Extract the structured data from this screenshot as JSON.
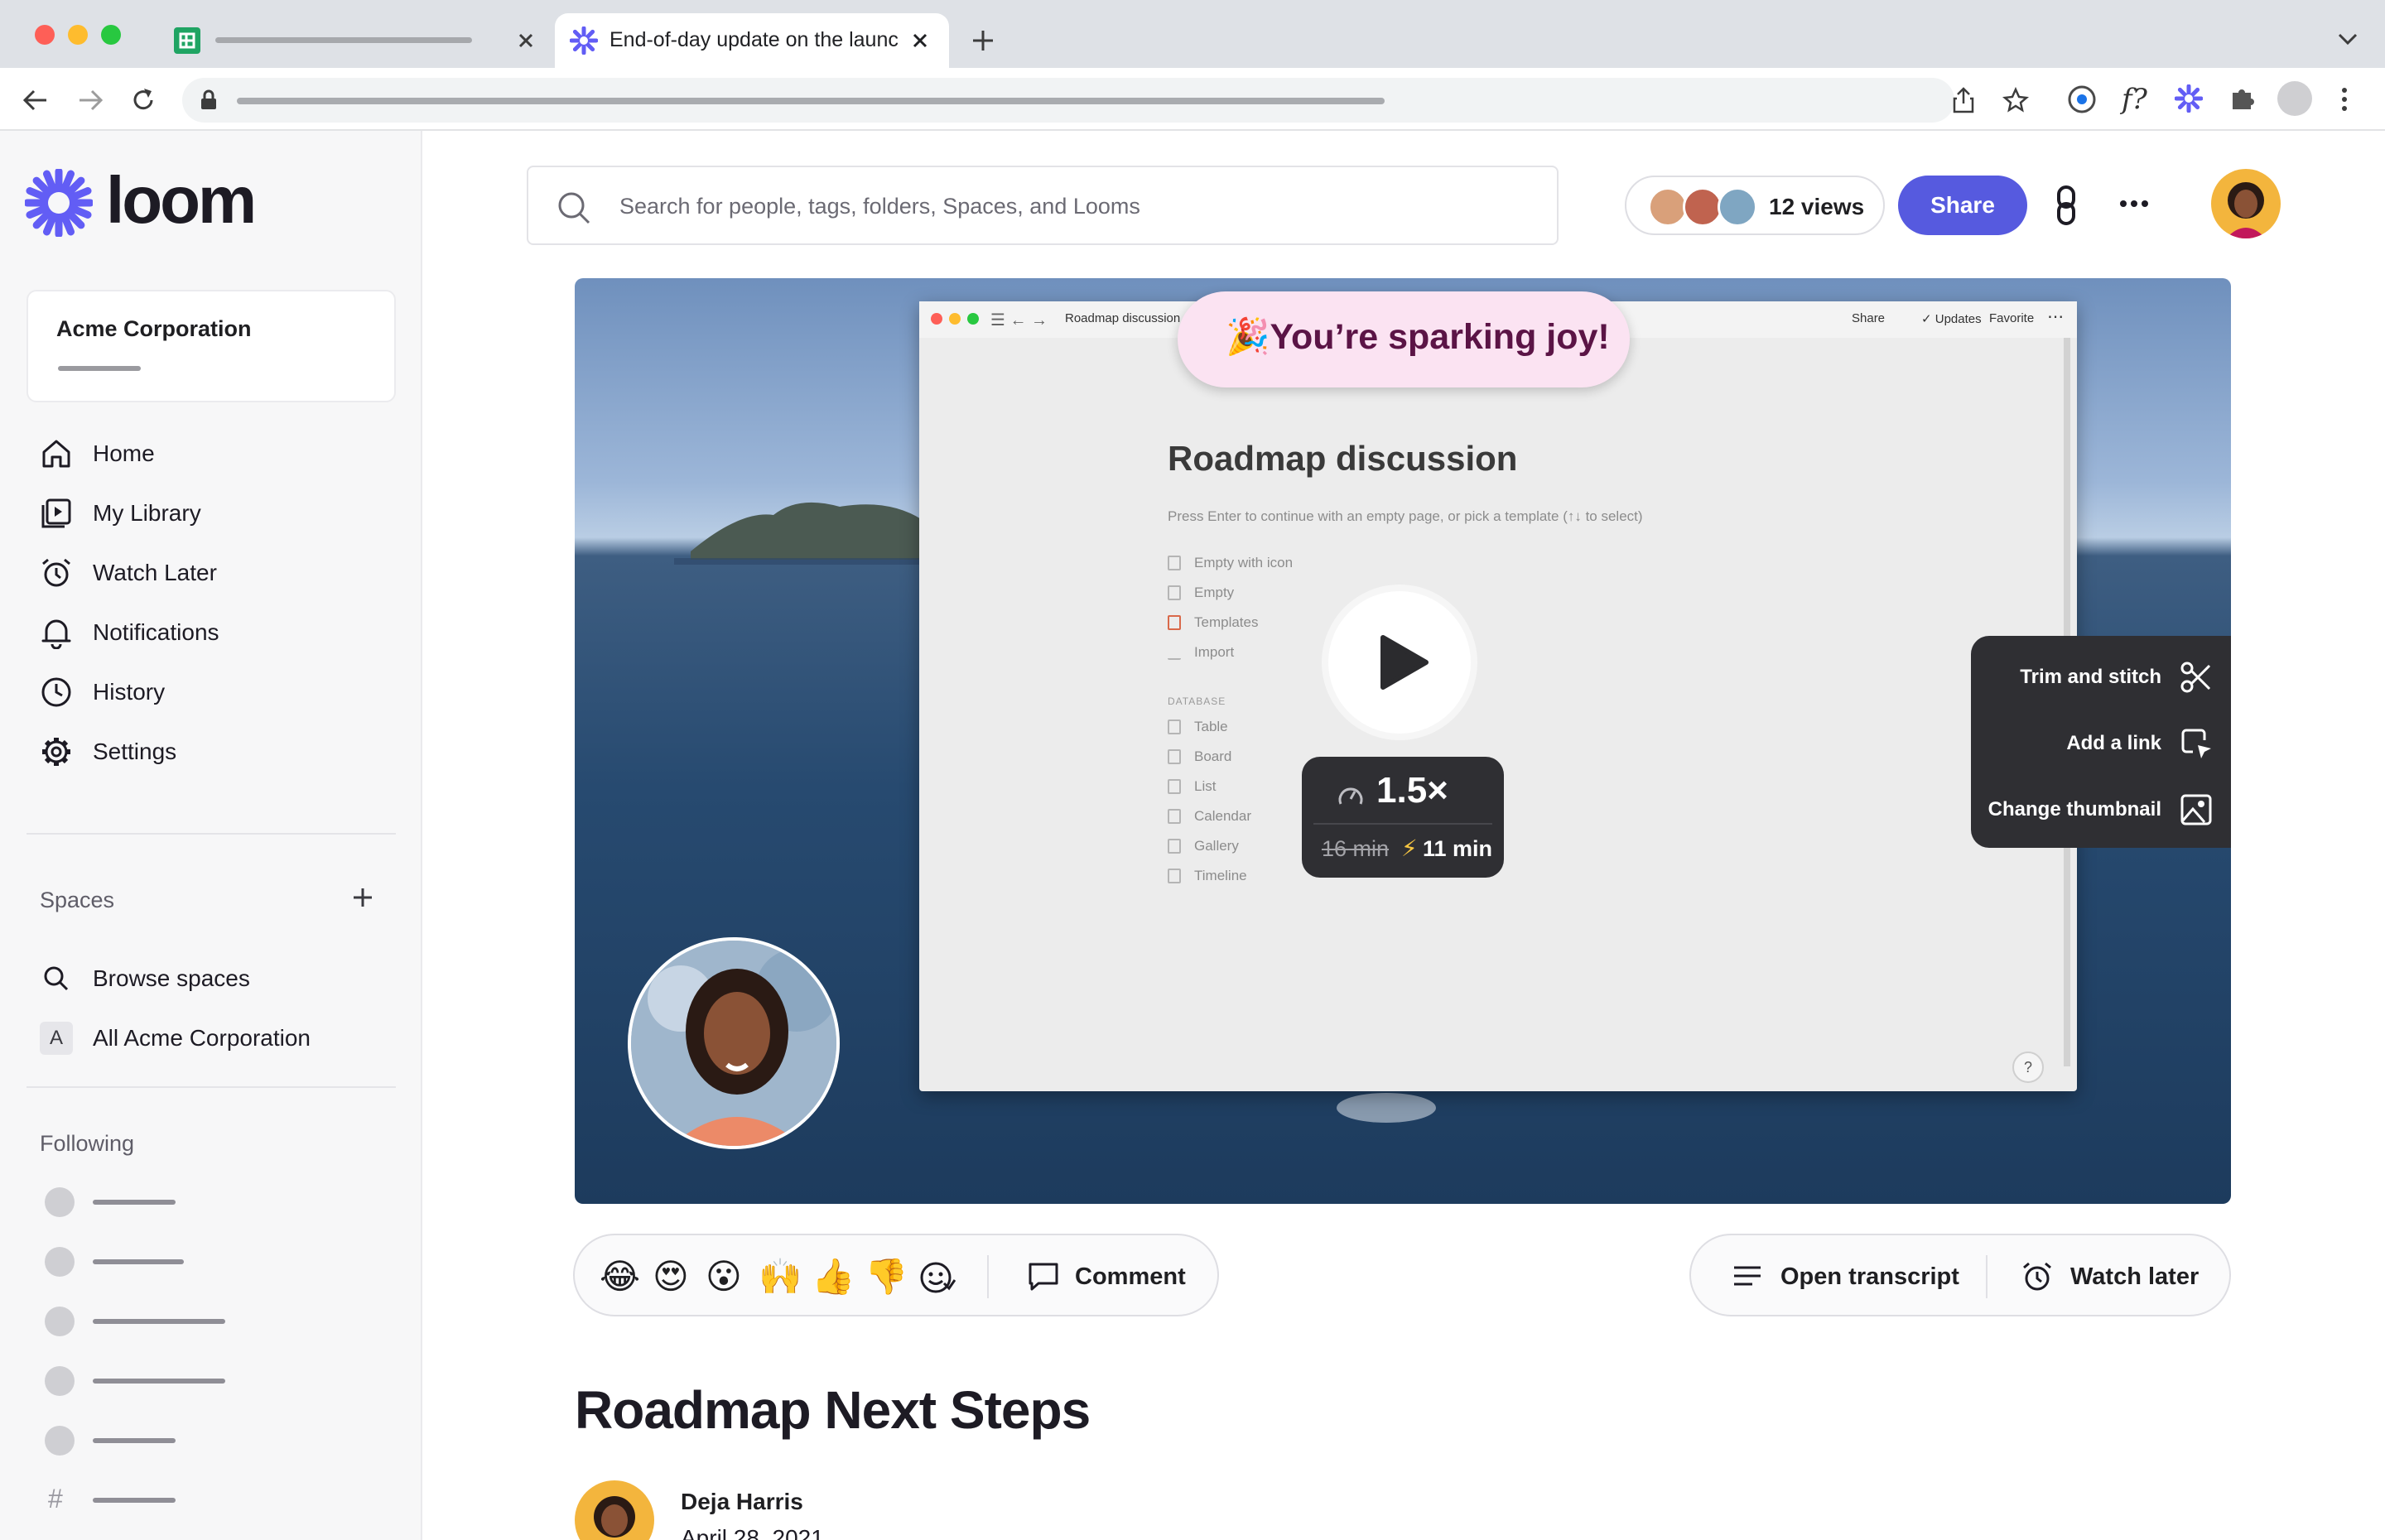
{
  "browser": {
    "tabs": [
      {
        "label": ""
      },
      {
        "label": "End-of-day update on the launc"
      }
    ],
    "url": ""
  },
  "sidebar": {
    "brand": "loom",
    "workspace": "Acme Corporation",
    "nav": [
      {
        "label": "Home",
        "icon": "home-icon"
      },
      {
        "label": "My Library",
        "icon": "library-icon"
      },
      {
        "label": "Watch Later",
        "icon": "alarm-clock-icon"
      },
      {
        "label": "Notifications",
        "icon": "bell-icon"
      },
      {
        "label": "History",
        "icon": "clock-icon"
      },
      {
        "label": "Settings",
        "icon": "gear-icon"
      }
    ],
    "spaces_header": "Spaces",
    "spaces": [
      {
        "label": "Browse spaces",
        "icon": "search-icon"
      },
      {
        "label": "All Acme Corporation",
        "badge": "A"
      }
    ],
    "following_header": "Following",
    "following_badge": "#"
  },
  "header": {
    "search_placeholder": "Search for people, tags, folders, Spaces, and Looms",
    "views": "12 views",
    "share": "Share"
  },
  "video": {
    "banner": "You’re sparking joy!",
    "screen": {
      "tab_title": "Roadmap discussion",
      "actions": [
        "Share",
        "Updates",
        "Favorite"
      ],
      "page_title": "Roadmap discussion",
      "hint": "Press Enter to continue with an empty page, or pick a template (↑↓ to select)",
      "items": [
        "Empty with icon",
        "Empty",
        "Templates",
        "Import"
      ],
      "database_header": "DATABASE",
      "database_items": [
        "Table",
        "Board",
        "List",
        "Calendar",
        "Gallery",
        "Timeline"
      ],
      "help": "?"
    },
    "speed": "1.5×",
    "original_duration": "16 min",
    "new_duration": "11 min",
    "tools": [
      "Trim and stitch",
      "Add a link",
      "Change thumbnail"
    ]
  },
  "actions": {
    "reactions": [
      "😂",
      "😍",
      "😮",
      "🙌",
      "👍",
      "👎"
    ],
    "comment": "Comment",
    "open_transcript": "Open transcript",
    "watch_later": "Watch later"
  },
  "video_title": "Roadmap Next Steps",
  "author": {
    "name": "Deja Harris",
    "date": "April 28, 2021"
  },
  "colors": {
    "accent": "#565adf",
    "brand": "#625df5",
    "banner_text": "#5b1446"
  }
}
